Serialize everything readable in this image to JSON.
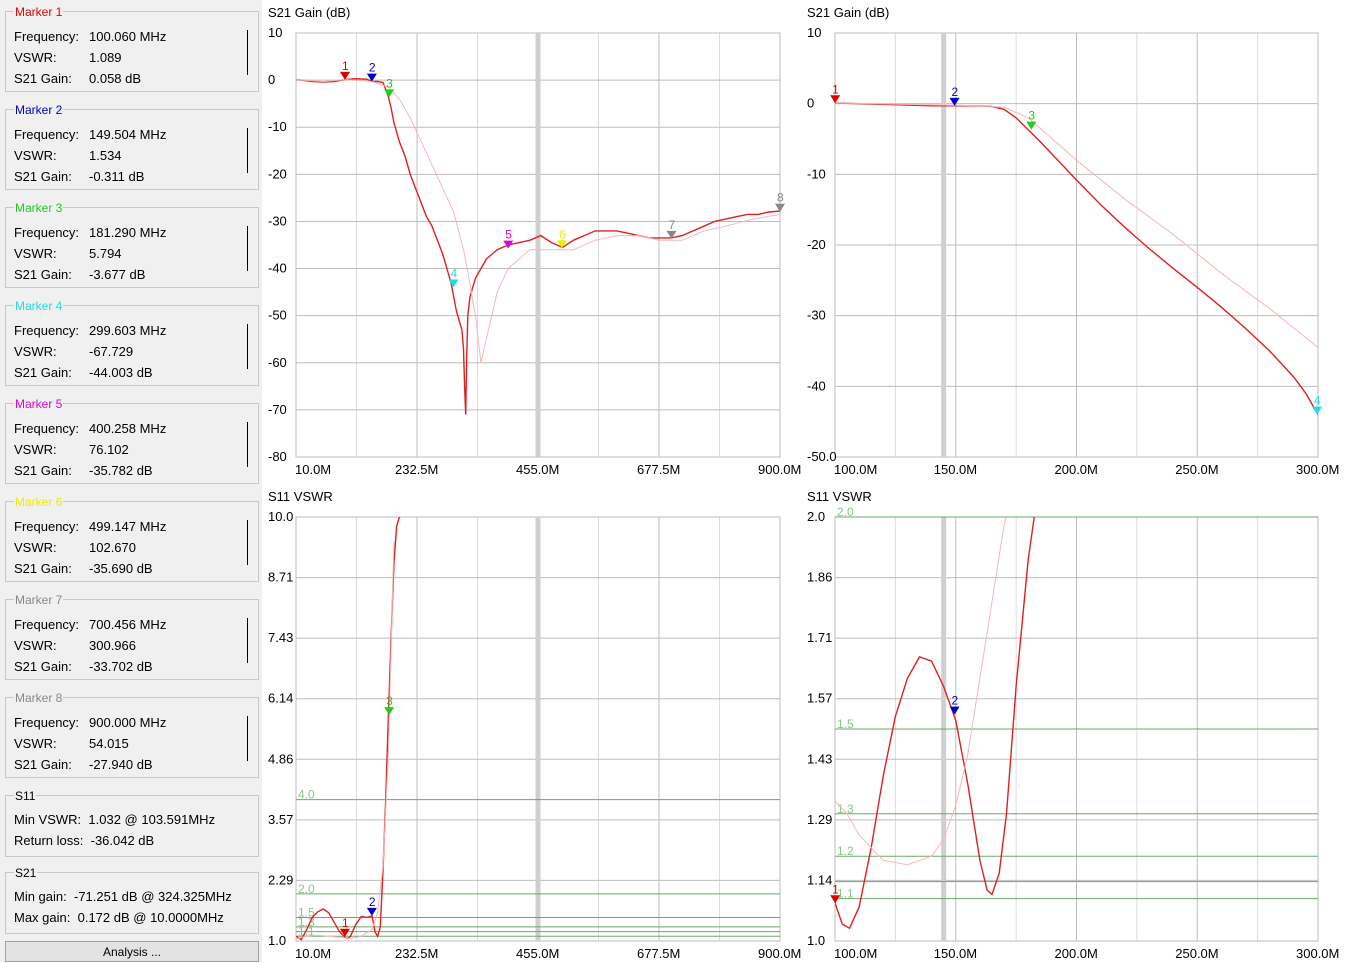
{
  "markers": [
    {
      "title": "Marker 1",
      "color": "#e00000",
      "frequency": "100.060 MHz",
      "vswr": "1.089",
      "gain": "0.058 dB"
    },
    {
      "title": "Marker 2",
      "color": "#0000cc",
      "frequency": "149.504 MHz",
      "vswr": "1.534",
      "gain": "-0.311 dB"
    },
    {
      "title": "Marker 3",
      "color": "#22cc22",
      "frequency": "181.290 MHz",
      "vswr": "5.794",
      "gain": "-3.677 dB"
    },
    {
      "title": "Marker 4",
      "color": "#22dddd",
      "frequency": "299.603 MHz",
      "vswr": "-67.729",
      "gain": "-44.003 dB"
    },
    {
      "title": "Marker 5",
      "color": "#dd00dd",
      "frequency": "400.258 MHz",
      "vswr": "76.102",
      "gain": "-35.782 dB"
    },
    {
      "title": "Marker 6",
      "color": "#eeee00",
      "frequency": "499.147 MHz",
      "vswr": "102.670",
      "gain": "-35.690 dB"
    },
    {
      "title": "Marker 7",
      "color": "#888888",
      "frequency": "700.456 MHz",
      "vswr": "300.966",
      "gain": "-33.702 dB"
    },
    {
      "title": "Marker 8",
      "color": "#888888",
      "frequency": "900.000 MHz",
      "vswr": "54.015",
      "gain": "-27.940 dB"
    }
  ],
  "labels": {
    "frequency": "Frequency:",
    "vswr": "VSWR:",
    "gain": "S21 Gain:"
  },
  "s11_summary": {
    "title": "S11",
    "min_vswr_label": "Min VSWR:",
    "min_vswr": "1.032 @ 103.591MHz",
    "return_loss_label": "Return loss:",
    "return_loss": "-36.042 dB"
  },
  "s21_summary": {
    "title": "S21",
    "min_gain_label": "Min gain:",
    "min_gain": "-71.251 dB @ 324.325MHz",
    "max_gain_label": "Max gain:",
    "max_gain": "0.172 dB @ 10.0000MHz"
  },
  "analysis_button": "Analysis ...",
  "chart_data": [
    {
      "type": "line",
      "title": "S21  Gain (dB)",
      "x_tick_labels": [
        "10.0M",
        "232.5M",
        "455.0M",
        "677.5M",
        "900.0M"
      ],
      "y_tick_labels": [
        "10",
        "0",
        "-10",
        "-20",
        "-30",
        "-40",
        "-50",
        "-60",
        "-70",
        "-80"
      ],
      "xlim": [
        10,
        900
      ],
      "ylim": [
        -80,
        10
      ],
      "band_mhz": 455,
      "series": [
        {
          "style": "main",
          "x": [
            10,
            20,
            40,
            60,
            80,
            100,
            120,
            140,
            150,
            160,
            170,
            180,
            185,
            190,
            200,
            210,
            220,
            230,
            240,
            250,
            260,
            270,
            280,
            290,
            295,
            300,
            305,
            310,
            315,
            318,
            320,
            322,
            324,
            326,
            330,
            335,
            340,
            345,
            350,
            360,
            370,
            380,
            400,
            420,
            440,
            460,
            480,
            500,
            520,
            540,
            560,
            580,
            600,
            620,
            640,
            660,
            680,
            700,
            720,
            740,
            760,
            780,
            800,
            820,
            840,
            860,
            880,
            900
          ],
          "y": [
            0.1,
            0,
            -0.3,
            -0.4,
            -0.3,
            0.1,
            0.3,
            0.2,
            -0.3,
            -0.3,
            -0.5,
            -3.5,
            -6,
            -9,
            -13,
            -16,
            -20,
            -23,
            -26,
            -29,
            -31,
            -34,
            -37,
            -41,
            -43,
            -46,
            -49,
            -51,
            -53,
            -57,
            -65,
            -71,
            -58,
            -50,
            -46,
            -44,
            -42,
            -41,
            -40,
            -38,
            -37,
            -36,
            -35,
            -34.5,
            -34,
            -33,
            -34.5,
            -35.5,
            -34,
            -33,
            -32,
            -32,
            -32,
            -32.5,
            -33,
            -33.5,
            -33.5,
            -33.5,
            -33,
            -32,
            -31,
            -30,
            -29.5,
            -29,
            -28.5,
            -28.5,
            -28,
            -27.8
          ]
        },
        {
          "style": "reference",
          "x": [
            10,
            60,
            100,
            150,
            180,
            200,
            220,
            240,
            260,
            280,
            300,
            320,
            340,
            350,
            360,
            380,
            400,
            440,
            480,
            520,
            560,
            600,
            640,
            680,
            720,
            760,
            800,
            850,
            900
          ],
          "y": [
            0.1,
            -0.3,
            0.1,
            -0.3,
            -1.5,
            -4,
            -8,
            -13,
            -18,
            -23,
            -28,
            -37,
            -50,
            -60,
            -55,
            -45,
            -40,
            -36,
            -36,
            -36,
            -34,
            -33,
            -33,
            -34,
            -34,
            -32,
            -31,
            -29.5,
            -28.5
          ]
        }
      ],
      "markers": [
        {
          "n": "1",
          "x": 100,
          "y": 0.058
        },
        {
          "n": "2",
          "x": 149.5,
          "y": -0.311
        },
        {
          "n": "3",
          "x": 181.3,
          "y": -3.677
        },
        {
          "n": "4",
          "x": 299.6,
          "y": -44.003
        },
        {
          "n": "5",
          "x": 400.3,
          "y": -35.782
        },
        {
          "n": "6",
          "x": 499.1,
          "y": -35.69
        },
        {
          "n": "7",
          "x": 700.5,
          "y": -33.702
        },
        {
          "n": "8",
          "x": 900,
          "y": -27.94
        }
      ]
    },
    {
      "type": "line",
      "title": "S21  Gain (dB)",
      "x_tick_labels": [
        "100.0M",
        "150.0M",
        "200.0M",
        "250.0M",
        "300.0M"
      ],
      "y_tick_labels": [
        "10",
        "0",
        "-10",
        "-20",
        "-30",
        "-40",
        "-50.0"
      ],
      "xlim": [
        100,
        300
      ],
      "ylim": [
        -50,
        10
      ],
      "band_mhz": 145,
      "series": [
        {
          "style": "main",
          "x": [
            100,
            110,
            120,
            130,
            140,
            150,
            160,
            165,
            170,
            175,
            180,
            185,
            190,
            200,
            210,
            220,
            230,
            240,
            250,
            260,
            270,
            280,
            290,
            295,
            300
          ],
          "y": [
            0.1,
            0,
            -0.1,
            -0.2,
            -0.3,
            -0.3,
            -0.3,
            -0.4,
            -0.8,
            -2,
            -3.7,
            -5.4,
            -7.2,
            -10.8,
            -14.3,
            -17.5,
            -20.5,
            -23.3,
            -26,
            -28.8,
            -31.8,
            -35,
            -38.7,
            -41,
            -44
          ]
        },
        {
          "style": "reference",
          "x": [
            100,
            130,
            160,
            170,
            180,
            190,
            200,
            220,
            240,
            260,
            280,
            300
          ],
          "y": [
            0.1,
            -0.1,
            -0.3,
            -0.5,
            -2,
            -5,
            -8,
            -13.5,
            -18.5,
            -24,
            -29,
            -34.5
          ]
        }
      ],
      "markers": [
        {
          "n": "1",
          "x": 100.06,
          "y": 0.058
        },
        {
          "n": "2",
          "x": 149.5,
          "y": -0.311
        },
        {
          "n": "3",
          "x": 181.3,
          "y": -3.677
        },
        {
          "n": "4",
          "x": 299.6,
          "y": -44.003
        }
      ]
    },
    {
      "type": "line",
      "title": "S11  VSWR",
      "x_tick_labels": [
        "10.0M",
        "232.5M",
        "455.0M",
        "677.5M",
        "900.0M"
      ],
      "y_tick_labels": [
        "10.0",
        "8.71",
        "7.43",
        "6.14",
        "4.86",
        "3.57",
        "2.29",
        "1.0"
      ],
      "xlim": [
        10,
        900
      ],
      "ylim": [
        1,
        10
      ],
      "band_mhz": 455,
      "ref_lines": [
        {
          "v": 4.0,
          "label": "4.0"
        },
        {
          "v": 2.0,
          "label": "2.0"
        },
        {
          "v": 1.5,
          "label": "1.5"
        },
        {
          "v": 1.3,
          "label": "1.3"
        },
        {
          "v": 1.2,
          "label": ""
        },
        {
          "v": 1.1,
          "label": "1.1"
        }
      ],
      "series": [
        {
          "style": "main",
          "x": [
            10,
            20,
            30,
            40,
            50,
            60,
            70,
            80,
            90,
            100,
            105,
            110,
            120,
            130,
            140,
            150,
            155,
            160,
            165,
            170,
            175,
            180,
            185,
            190,
            195,
            200
          ],
          "y": [
            1.1,
            1.03,
            1.25,
            1.5,
            1.62,
            1.68,
            1.6,
            1.4,
            1.2,
            1.08,
            1.05,
            1.1,
            1.35,
            1.52,
            1.5,
            1.53,
            1.2,
            1.1,
            1.3,
            2.5,
            4,
            5.8,
            7.5,
            9,
            9.8,
            10
          ]
        },
        {
          "style": "reference",
          "x": [
            10,
            30,
            50,
            70,
            90,
            110,
            130,
            150,
            160,
            170,
            180,
            190
          ],
          "y": [
            1.05,
            1.1,
            1.12,
            1.1,
            1.08,
            1.05,
            1.1,
            1.25,
            1.6,
            2.6,
            5,
            9.5
          ]
        }
      ],
      "markers": [
        {
          "n": "1",
          "x": 100.06,
          "y": 1.089
        },
        {
          "n": "2",
          "x": 149.5,
          "y": 1.534
        },
        {
          "n": "3",
          "x": 181.3,
          "y": 5.794
        }
      ]
    },
    {
      "type": "line",
      "title": "S11  VSWR",
      "x_tick_labels": [
        "100.0M",
        "150.0M",
        "200.0M",
        "250.0M",
        "300.0M"
      ],
      "y_tick_labels": [
        "2.0",
        "1.86",
        "1.71",
        "1.57",
        "1.43",
        "1.29",
        "1.14",
        "1.0"
      ],
      "xlim": [
        100,
        300
      ],
      "ylim": [
        1,
        2
      ],
      "band_mhz": 145,
      "ref_lines": [
        {
          "v": 2.0,
          "label": "2.0"
        },
        {
          "v": 1.5,
          "label": "1.5"
        },
        {
          "v": 1.3,
          "label": "1.3"
        },
        {
          "v": 1.2,
          "label": "1.2"
        },
        {
          "v": 1.1,
          "label": "1.1"
        },
        {
          "v": 1.14,
          "label": ""
        }
      ],
      "series": [
        {
          "style": "main",
          "x": [
            100,
            103,
            106,
            110,
            115,
            120,
            125,
            130,
            135,
            140,
            145,
            150,
            155,
            160,
            163,
            165,
            168,
            171,
            175,
            180,
            185,
            190
          ],
          "y": [
            1.09,
            1.04,
            1.03,
            1.08,
            1.22,
            1.39,
            1.53,
            1.62,
            1.67,
            1.66,
            1.6,
            1.52,
            1.37,
            1.19,
            1.12,
            1.11,
            1.16,
            1.3,
            1.6,
            1.9,
            2.1,
            2.3
          ]
        },
        {
          "style": "reference",
          "x": [
            100,
            105,
            110,
            120,
            130,
            140,
            145,
            150,
            155,
            160,
            165,
            170,
            175,
            180,
            185
          ],
          "y": [
            1.33,
            1.3,
            1.25,
            1.19,
            1.18,
            1.2,
            1.24,
            1.32,
            1.44,
            1.62,
            1.8,
            1.98,
            2.1,
            2.25,
            2.4
          ]
        }
      ],
      "markers": [
        {
          "n": "1",
          "x": 100.06,
          "y": 1.089
        },
        {
          "n": "2",
          "x": 149.5,
          "y": 1.534
        }
      ]
    }
  ]
}
